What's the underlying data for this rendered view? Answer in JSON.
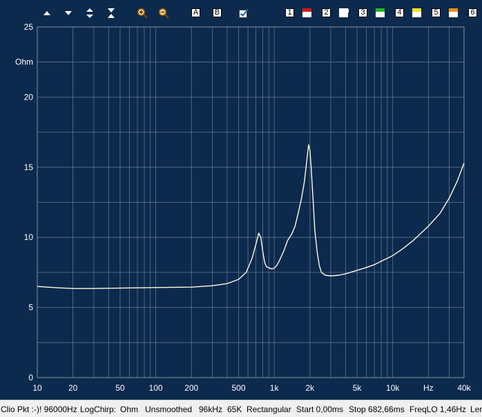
{
  "toolbar": {
    "buttons": [
      {
        "name": "arrow-up-icon"
      },
      {
        "name": "arrow-down-icon"
      },
      {
        "name": "expand-vertical-icon"
      },
      {
        "name": "compress-vertical-icon"
      },
      {
        "name": "zoom-in-icon"
      },
      {
        "name": "zoom-out-icon"
      },
      {
        "name": "cursor-a-button",
        "label": "A"
      },
      {
        "name": "cursor-b-button",
        "label": "B"
      },
      {
        "name": "checkbox-icon"
      }
    ],
    "overlays": [
      {
        "label": "1",
        "color": "#d11a1a"
      },
      {
        "label": "2",
        "color": "#ffffff"
      },
      {
        "label": "3",
        "color": "#1fb81f"
      },
      {
        "label": "4",
        "color": "#f2e21a"
      },
      {
        "label": "5",
        "color": "#f08a1a"
      },
      {
        "label": "6",
        "color": ""
      }
    ]
  },
  "chart_data": {
    "type": "line",
    "title": "",
    "xlabel": "Hz",
    "ylabel": "Ohm",
    "x_scale": "log",
    "xlim": [
      10,
      40000
    ],
    "ylim": [
      0,
      25
    ],
    "grid": true,
    "x_tick_labels": [
      {
        "v": 10,
        "t": "10"
      },
      {
        "v": 20,
        "t": "20"
      },
      {
        "v": 50,
        "t": "50"
      },
      {
        "v": 100,
        "t": "100"
      },
      {
        "v": 200,
        "t": "200"
      },
      {
        "v": 500,
        "t": "500"
      },
      {
        "v": 1000,
        "t": "1k"
      },
      {
        "v": 2000,
        "t": "2k"
      },
      {
        "v": 5000,
        "t": "5k"
      },
      {
        "v": 10000,
        "t": "10k"
      },
      {
        "v": 20000,
        "t": "Hz"
      },
      {
        "v": 40000,
        "t": "40k"
      }
    ],
    "y_tick_labels": [
      {
        "v": 0,
        "t": "0"
      },
      {
        "v": 5,
        "t": "5"
      },
      {
        "v": 10,
        "t": "10"
      },
      {
        "v": 15,
        "t": "15"
      },
      {
        "v": 20,
        "t": "20"
      },
      {
        "v": 22.5,
        "t": "Ohm"
      },
      {
        "v": 25,
        "t": "25"
      }
    ],
    "series": [
      {
        "color": "#fffbe0",
        "x": [
          10,
          15,
          20,
          30,
          50,
          100,
          200,
          300,
          400,
          500,
          580,
          650,
          700,
          740,
          770,
          800,
          830,
          860,
          890,
          920,
          950,
          1000,
          1050,
          1100,
          1200,
          1300,
          1400,
          1500,
          1600,
          1700,
          1800,
          1900,
          1950,
          2000,
          2050,
          2100,
          2150,
          2200,
          2300,
          2400,
          2500,
          2700,
          3000,
          3500,
          4000,
          5000,
          6000,
          7000,
          8000,
          10000,
          12000,
          15000,
          20000,
          25000,
          30000,
          35000,
          40000
        ],
        "y": [
          6.5,
          6.4,
          6.35,
          6.35,
          6.38,
          6.42,
          6.45,
          6.55,
          6.7,
          7.0,
          7.5,
          8.5,
          9.5,
          10.3,
          10.0,
          9.0,
          8.2,
          7.9,
          7.85,
          7.8,
          7.75,
          7.8,
          8.0,
          8.3,
          9.0,
          9.8,
          10.2,
          10.8,
          11.8,
          12.8,
          14.0,
          15.8,
          16.6,
          16.2,
          15.0,
          13.5,
          12.0,
          10.5,
          9.0,
          8.0,
          7.5,
          7.3,
          7.25,
          7.3,
          7.4,
          7.65,
          7.85,
          8.05,
          8.3,
          8.7,
          9.15,
          9.8,
          10.8,
          11.7,
          12.8,
          14.0,
          15.3
        ]
      }
    ]
  },
  "status": {
    "items": [
      "Clio Pkt :-)! 96000Hz",
      "LogChirp:",
      "Ohm",
      "Unsmoothed",
      "96kHz",
      "65K",
      "Rectangular",
      "Start 0,00ms",
      "Stop 682,66ms",
      "FreqLO 1,46Hz",
      "Ler"
    ]
  }
}
